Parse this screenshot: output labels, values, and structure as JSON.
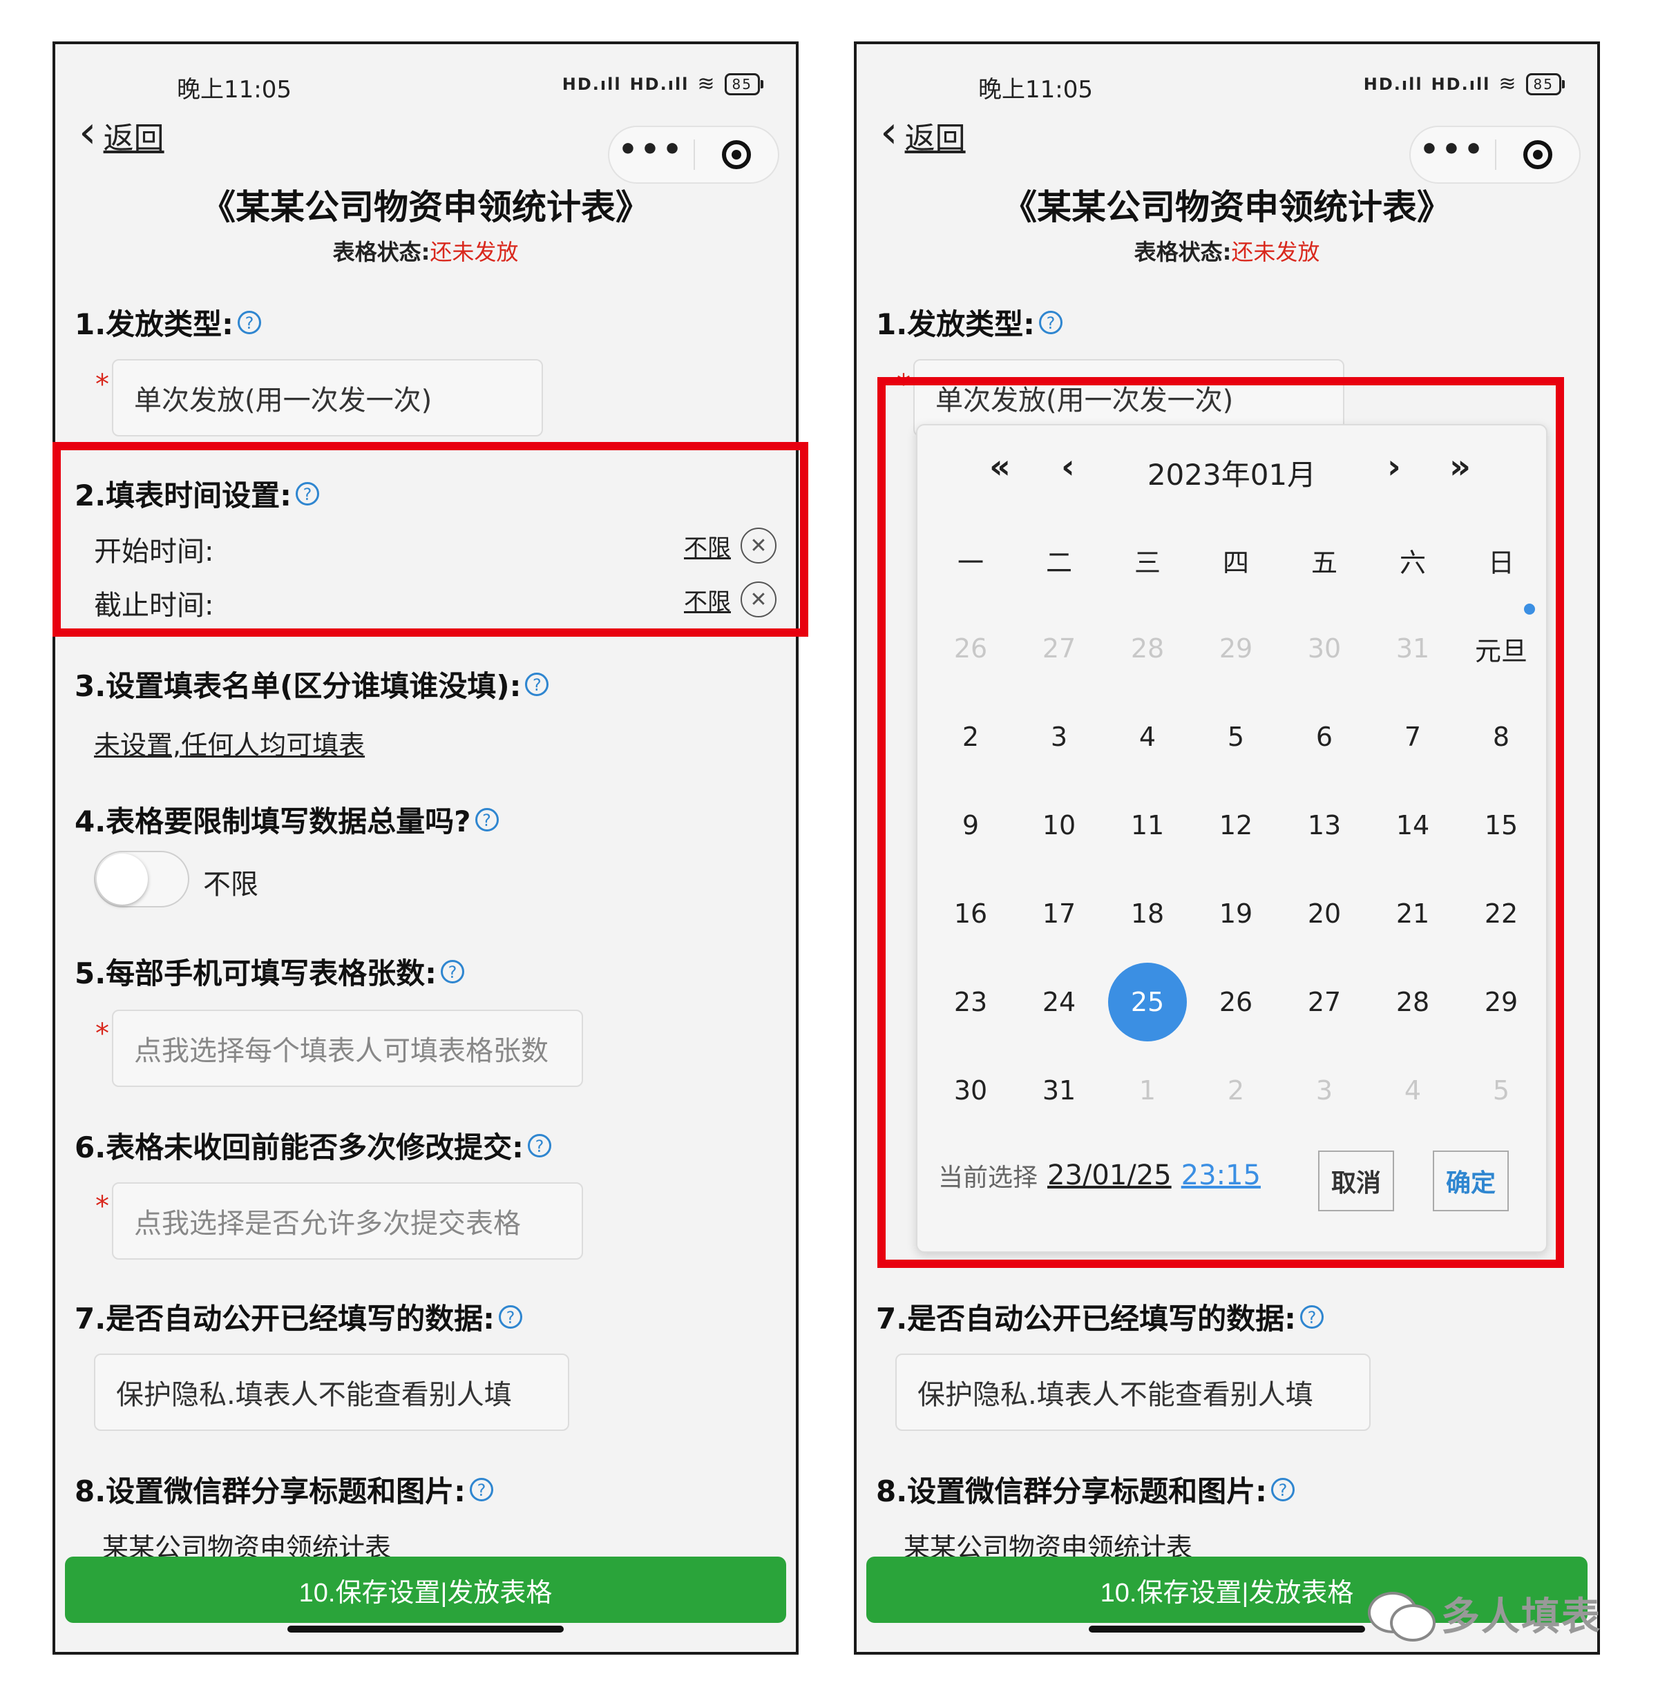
{
  "status_bar": {
    "time": "晚上11:05",
    "signal1": "HD.ıll",
    "signal2": "HD.ıll",
    "wifi": "≋",
    "battery": "85"
  },
  "nav": {
    "back_label": "返回",
    "more_icon": "•••"
  },
  "header": {
    "title": "《某某公司物资申领统计表》",
    "status_label": "表格状态:",
    "status_value": "还未发放"
  },
  "sections": {
    "s1": {
      "title": "1.发放类型:",
      "value": "单次发放(用一次发一次)"
    },
    "s2": {
      "title": "2.填表时间设置:",
      "start_label": "开始时间:",
      "end_label": "截止时间:",
      "start_value": "不限",
      "end_value": "不限"
    },
    "s3": {
      "title": "3.设置填表名单(区分谁填谁没填):",
      "link": "未设置,任何人均可填表"
    },
    "s4": {
      "title": "4.表格要限制填写数据总量吗?",
      "toggle_label": "不限"
    },
    "s5": {
      "title": "5.每部手机可填写表格张数:",
      "placeholder": "点我选择每个填表人可填表格张数"
    },
    "s6": {
      "title": "6.表格未收回前能否多次修改提交:",
      "placeholder": "点我选择是否允许多次提交表格"
    },
    "s7": {
      "title": "7.是否自动公开已经填写的数据:",
      "value": "保护隐私.填表人不能查看别人填"
    },
    "s8": {
      "title": "8.设置微信群分享标题和图片:",
      "link": "某某公司物资申领统计表"
    }
  },
  "required_mark": "*",
  "help_mark": "?",
  "clear_mark": "✕",
  "save_button": "10.保存设置|发放表格",
  "calendar": {
    "title": "2023年01月",
    "nav_prev_year": "«",
    "nav_prev_month": "‹",
    "nav_next_month": "›",
    "nav_next_year": "»",
    "weekdays": [
      "一",
      "二",
      "三",
      "四",
      "五",
      "六",
      "日"
    ],
    "weeks": [
      [
        "26",
        "27",
        "28",
        "29",
        "30",
        "31",
        "元旦"
      ],
      [
        "2",
        "3",
        "4",
        "5",
        "6",
        "7",
        "8"
      ],
      [
        "9",
        "10",
        "11",
        "12",
        "13",
        "14",
        "15"
      ],
      [
        "16",
        "17",
        "18",
        "19",
        "20",
        "21",
        "22"
      ],
      [
        "23",
        "24",
        "25",
        "26",
        "27",
        "28",
        "29"
      ],
      [
        "30",
        "31",
        "1",
        "2",
        "3",
        "4",
        "5"
      ]
    ],
    "selected_day": "25",
    "current_label": "当前选择",
    "current_date": "23/01/25",
    "current_time": "23:15",
    "cancel": "取消",
    "confirm": "确定",
    "selected_color": "#3b8fe3"
  },
  "watermark": {
    "text": "多人填表",
    "icon": "wechat-icon"
  },
  "colors": {
    "accent_green": "#2aa43a",
    "status_red": "#d9281d",
    "highlight_red": "#e8000f",
    "link_blue": "#2f86d0"
  }
}
